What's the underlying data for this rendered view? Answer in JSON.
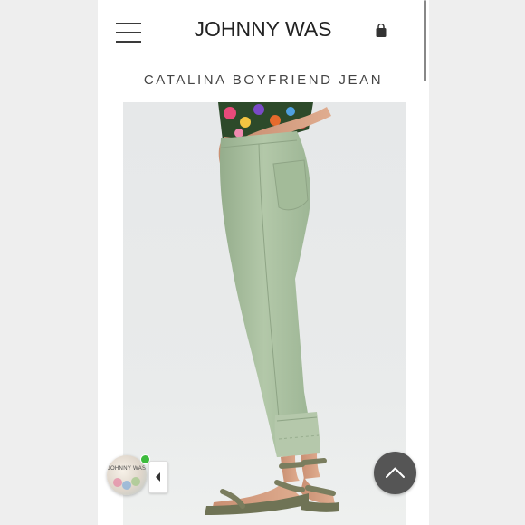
{
  "header": {
    "brand": "JOHNNY WAS",
    "menu_icon": "hamburger-menu-icon",
    "bag_icon": "shopping-bag-icon"
  },
  "product": {
    "title": "CATALINA BOYFRIEND JEAN",
    "image_alt": "model wearing sage green cuffed boyfriend jeans with olive sandals"
  },
  "chat_widget": {
    "avatar_text": "JOHNNY WAS",
    "status": "online",
    "status_color": "#3dbb3d",
    "toggle_icon": "chevron-left-icon"
  },
  "scroll_top": {
    "icon": "chevron-up-icon"
  },
  "colors": {
    "jeans": "#a9bfa0",
    "sandals": "#7a7d5e",
    "scroll_button": "#555555"
  }
}
